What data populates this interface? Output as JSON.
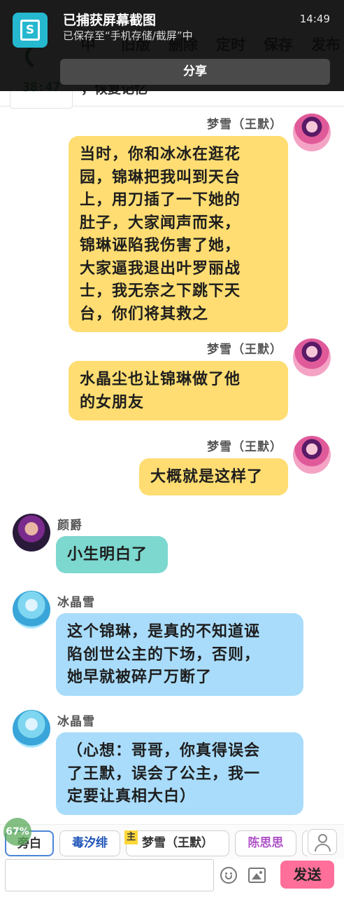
{
  "toolbar": {
    "timer": "38:47",
    "items": [
      "中",
      "旧版",
      "删除",
      "定时",
      "保存",
      "发布"
    ],
    "restore_text": "，恢复记忆"
  },
  "notification": {
    "title": "已捕获屏幕截图",
    "subtitle": "已保存至“手机存储/截屏”中",
    "time": "14:49",
    "share_label": "分享"
  },
  "messages": [
    {
      "speaker": "梦雪（王默）",
      "side": "right",
      "color": "yellow",
      "lines": [
        "当时，你和冰冰在逛花",
        "园，锦琳把我叫到天台",
        "上，用刀插了一下她的",
        "肚子，大家闻声而来，",
        "锦琳诬陷我伤害了她，",
        "大家逼我退出叶罗丽战",
        "士，我无奈之下跳下天",
        "台，你们将其救之"
      ]
    },
    {
      "speaker": "梦雪（王默）",
      "side": "right",
      "color": "yellow",
      "lines": [
        "水晶尘也让锦琳做了他",
        "的女朋友"
      ]
    },
    {
      "speaker": "梦雪（王默）",
      "side": "right",
      "color": "yellow",
      "lines": [
        "大概就是这样了"
      ]
    },
    {
      "speaker": "颜爵",
      "side": "left",
      "color": "teal",
      "lines": [
        "小生明白了"
      ]
    },
    {
      "speaker": "冰晶雪",
      "side": "left",
      "color": "blue",
      "lines": [
        "这个锦琳，是真的不知道诬",
        "陷创世公主的下场，否则，",
        "她早就被碎尸万断了"
      ]
    },
    {
      "speaker": "冰晶雪",
      "side": "left",
      "color": "blue",
      "lines": [
        "（心想：哥哥，你真得误会",
        "了王默，误会了公主，我一",
        "定要让真相大白）"
      ]
    }
  ],
  "characters": {
    "narrator": "旁白",
    "du": "毒汐绯",
    "host_badge": "主",
    "mengxue": "梦雪（王默）",
    "chen": "陈思思"
  },
  "progress_badge": "67%",
  "input": {
    "value": "",
    "send_label": "发送"
  },
  "colors": {
    "bubble_yellow": "#ffdd72",
    "bubble_teal": "#7dd8cf",
    "bubble_blue": "#a9dcfa",
    "send_button": "#ff6f9a",
    "notification_icon": "#25b8cf"
  }
}
